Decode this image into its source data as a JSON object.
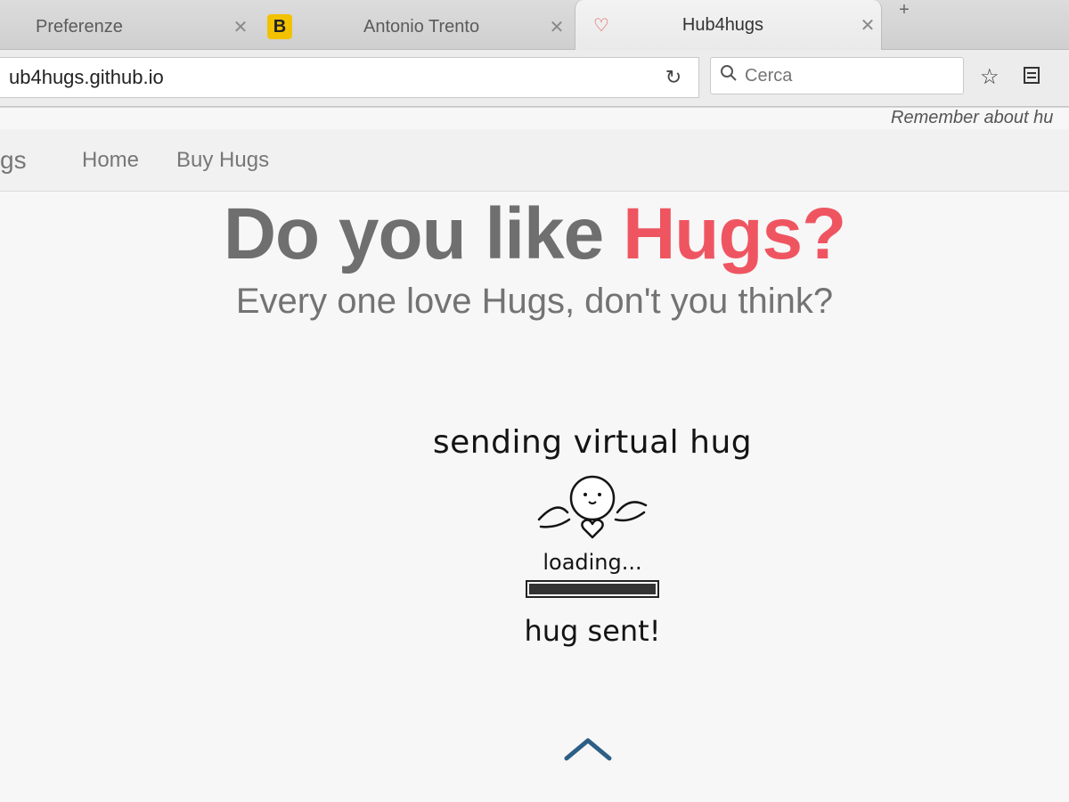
{
  "browser": {
    "tabs": [
      {
        "title": "Preferenze",
        "close": "✕"
      },
      {
        "title": "Antonio Trento",
        "close": "✕",
        "favicon_letter": "B"
      },
      {
        "title": "Hub4hugs",
        "close": "✕"
      }
    ],
    "new_tab": "+",
    "url": "ub4hugs.github.io",
    "reload": "↻",
    "search": {
      "placeholder": "Cerca"
    },
    "icons": [
      "star-icon",
      "reader-icon",
      "search-icon",
      "reload-icon",
      "heart-icon"
    ]
  },
  "page": {
    "reminder": "Remember about hu",
    "nav": {
      "brand": "gs",
      "links": [
        "Home",
        "Buy Hugs"
      ]
    },
    "hero": {
      "title_main": "Do you like ",
      "title_accent": "Hugs?",
      "subtitle": "Every one love Hugs, don't you think?"
    },
    "hug": {
      "sending": "sending virtual hug",
      "loading": "loading...",
      "sent": "hug sent!",
      "progress": 1.0
    },
    "colors": {
      "accent": "#ef5561",
      "scroll_arrow": "#2d5f86"
    }
  }
}
